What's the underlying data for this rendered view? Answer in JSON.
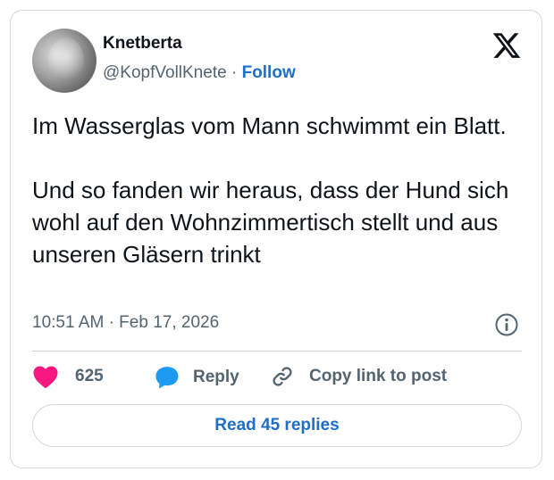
{
  "author": {
    "name": "Knetberta",
    "handle": "@KopfVollKnete",
    "separator": "·",
    "follow_label": "Follow"
  },
  "tweet": {
    "text": "Im Wasserglas vom Mann schwimmt ein Blatt.\n\nUnd so fanden wir heraus, dass der Hund sich wohl auf den Wohnzimmertisch stellt und aus unseren Gläsern trinkt",
    "time": "10:51 AM",
    "time_separator": "·",
    "date": "Feb 17, 2026"
  },
  "actions": {
    "like_count": "625",
    "reply_label": "Reply",
    "copy_label": "Copy link to post"
  },
  "read_replies_label": "Read 45 replies",
  "icons": {
    "like": "heart-icon",
    "reply": "speech-bubble-icon",
    "copy": "link-icon",
    "info": "info-icon",
    "logo": "x-logo-icon"
  },
  "colors": {
    "accent": "#1d6fc9",
    "like": "#f91880",
    "reply_bubble": "#1d9bf0",
    "muted_text": "#536471",
    "border": "#cfd9de"
  }
}
